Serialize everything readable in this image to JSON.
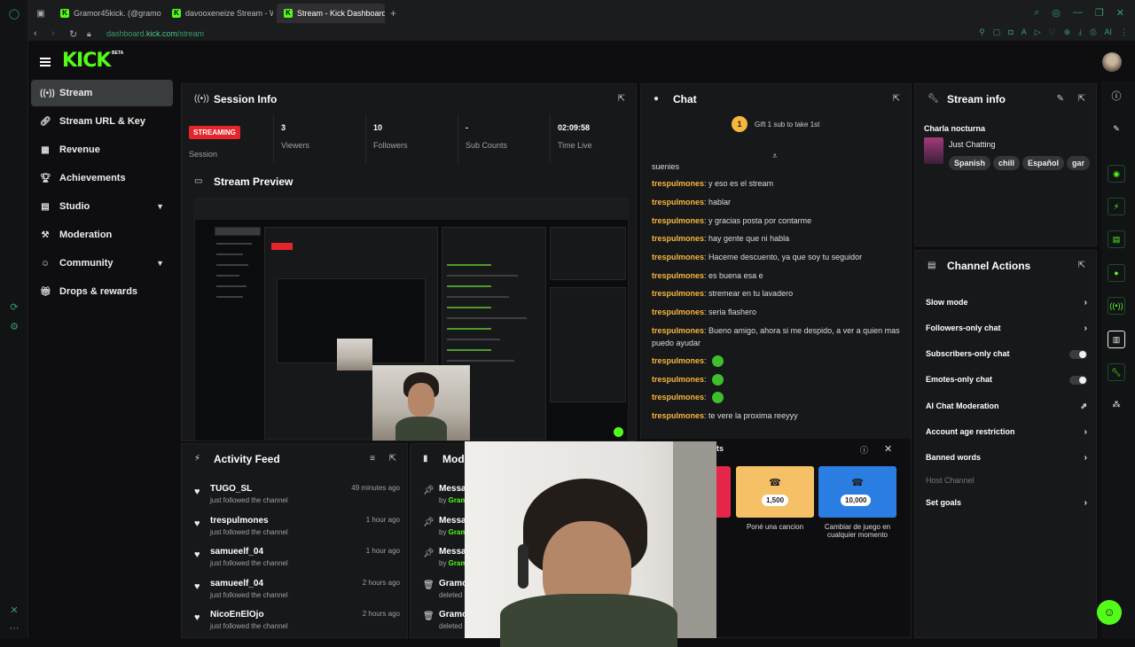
{
  "browser": {
    "tabs": [
      {
        "label": "Gramor45kick. (@gramor4",
        "active": false
      },
      {
        "label": "davooxeneize Stream - W",
        "active": false
      },
      {
        "label": "Stream - Kick Dashboard",
        "active": true
      }
    ],
    "url_host": "dashboard.",
    "url_domain": "kick.com",
    "url_path": "/stream",
    "ai_label": "AI"
  },
  "header": {
    "logo": "KICK",
    "beta": "BETA"
  },
  "sidebar": {
    "items": [
      {
        "label": "Stream",
        "icon": "broadcast-icon",
        "active": true
      },
      {
        "label": "Stream URL & Key",
        "icon": "link-icon"
      },
      {
        "label": "Revenue",
        "icon": "chart-icon"
      },
      {
        "label": "Achievements",
        "icon": "trophy-icon"
      },
      {
        "label": "Studio",
        "icon": "studio-icon",
        "expandable": true
      },
      {
        "label": "Moderation",
        "icon": "hammer-icon"
      },
      {
        "label": "Community",
        "icon": "community-icon",
        "expandable": true
      },
      {
        "label": "Drops & rewards",
        "icon": "gift-icon"
      }
    ]
  },
  "session": {
    "title": "Session Info",
    "status_badge": "STREAMING",
    "stats": [
      {
        "value": "",
        "label": "Session"
      },
      {
        "value": "3",
        "label": "Viewers"
      },
      {
        "value": "10",
        "label": "Followers"
      },
      {
        "value": "-",
        "label": "Sub Counts"
      },
      {
        "value": "02:09:58",
        "label": "Time Live"
      }
    ]
  },
  "preview": {
    "title": "Stream Preview"
  },
  "activity": {
    "title": "Activity Feed",
    "items": [
      {
        "name": "TUGO_SL",
        "desc": "just followed the channel",
        "time": "49 minutes ago"
      },
      {
        "name": "trespulmones",
        "desc": "just followed the channel",
        "time": "1 hour ago"
      },
      {
        "name": "samueelf_04",
        "desc": "just followed the channel",
        "time": "1 hour ago"
      },
      {
        "name": "samueelf_04",
        "desc": "just followed the channel",
        "time": "2 hours ago"
      },
      {
        "name": "NicoEnElOjo",
        "desc": "just followed the channel",
        "time": "2 hours ago"
      }
    ]
  },
  "mod_panel": {
    "title": "Mod",
    "items": [
      {
        "title": "Messa",
        "sub": "by ",
        "who": "Gram"
      },
      {
        "title": "Messa",
        "sub": "by ",
        "who": "Gram"
      },
      {
        "title": "Messa",
        "sub": "by ",
        "who": "Gram"
      },
      {
        "title": "Gramo",
        "sub": "deleted",
        "who": ""
      },
      {
        "title": "Gramo",
        "sub": "deleted",
        "who": ""
      }
    ]
  },
  "chat": {
    "title": "Chat",
    "gift_count": "1",
    "gift_text": "Gift 1 sub to take 1st",
    "first_line": "suenies",
    "messages": [
      {
        "user": "trespulmones",
        "text": "y eso es el stream"
      },
      {
        "user": "trespulmones",
        "text": "hablar"
      },
      {
        "user": "trespulmones",
        "text": "y gracias posta por contarme"
      },
      {
        "user": "trespulmones",
        "text": "hay gente que ni habla"
      },
      {
        "user": "trespulmones",
        "text": "Haceme descuento, ya que soy tu seguidor"
      },
      {
        "user": "trespulmones",
        "text": "es buena esa e"
      },
      {
        "user": "trespulmones",
        "text": "stremear en tu lavadero"
      },
      {
        "user": "trespulmones",
        "text": "seria flashero"
      },
      {
        "user": "trespulmones",
        "text": "Bueno amigo, ahora si me despido, a ver a quien mas puedo ayudar"
      },
      {
        "user": "trespulmones",
        "text": ""
      },
      {
        "user": "trespulmones",
        "text": ""
      },
      {
        "user": "trespulmones",
        "text": ""
      },
      {
        "user": "trespulmones",
        "text": "te vere la proxima reeyyy"
      }
    ]
  },
  "rewards": {
    "title_tail": "ts",
    "items": [
      {
        "cost": "1,500",
        "label": "Poné una cancion",
        "color": "#f6c066"
      },
      {
        "cost": "10,000",
        "label": "Cambiar de juego en cualquier momento",
        "color": "#2a7de1"
      }
    ],
    "partial_label": "s"
  },
  "stream_info": {
    "title": "Stream info",
    "stream_title": "Charla nocturna",
    "category": "Just Chatting",
    "tags": [
      "Spanish",
      "chill",
      "Español",
      "gar"
    ]
  },
  "channel_actions": {
    "title": "Channel Actions",
    "items": [
      {
        "label": "Slow mode",
        "control": "chevron"
      },
      {
        "label": "Followers-only chat",
        "control": "chevron"
      },
      {
        "label": "Subscribers-only chat",
        "control": "toggle"
      },
      {
        "label": "Emotes-only chat",
        "control": "toggle"
      },
      {
        "label": "AI Chat Moderation",
        "control": "external"
      },
      {
        "label": "Account age restriction",
        "control": "chevron"
      },
      {
        "label": "Banned words",
        "control": "chevron"
      },
      {
        "label": "Host Channel",
        "control": "none",
        "disabled": true
      },
      {
        "label": "Set goals",
        "control": "chevron"
      }
    ]
  },
  "colors": {
    "accent": "#53fc18",
    "chat_user": "#f6b73c",
    "streaming_badge": "#e5252c"
  }
}
